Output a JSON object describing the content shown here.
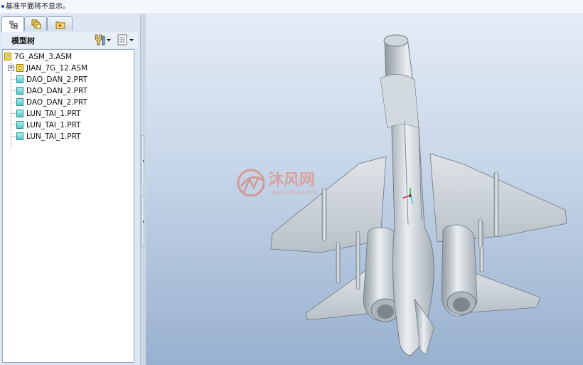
{
  "status": {
    "message": "基准平面将不显示。"
  },
  "navigator": {
    "title": "模型树",
    "tabs": [
      "model-tree-tab",
      "layers-tab",
      "favorites-tab"
    ]
  },
  "tree": {
    "root": {
      "label": "7G_ASM_3.ASM"
    },
    "items": [
      {
        "label": "JIAN_7G_12.ASM",
        "kind": "asm",
        "expandable": true
      },
      {
        "label": "DAO_DAN_2.PRT",
        "kind": "prt"
      },
      {
        "label": "DAO_DAN_2.PRT",
        "kind": "prt"
      },
      {
        "label": "DAO_DAN_2.PRT",
        "kind": "prt"
      },
      {
        "label": "LUN_TAI_1.PRT",
        "kind": "prt"
      },
      {
        "label": "LUN_TAI_1.PRT",
        "kind": "prt"
      },
      {
        "label": "LUN_TAI_1.PRT",
        "kind": "prt"
      }
    ],
    "expander_symbol": "+"
  },
  "watermark": {
    "text": "沐风网",
    "url": "www.mfcad.com"
  },
  "colors": {
    "accent": "#2050c8",
    "model": "#c7ced6",
    "watermark": "#e06a55"
  }
}
